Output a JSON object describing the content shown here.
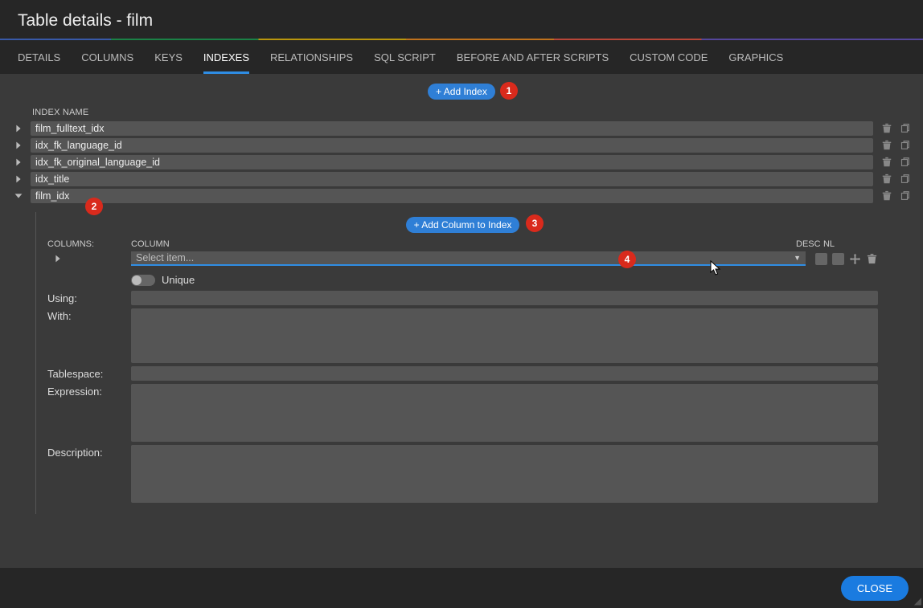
{
  "header": {
    "title": "Table details - film"
  },
  "tabs": [
    {
      "label": "DETAILS",
      "active": false
    },
    {
      "label": "COLUMNS",
      "active": false
    },
    {
      "label": "KEYS",
      "active": false
    },
    {
      "label": "INDEXES",
      "active": true
    },
    {
      "label": "RELATIONSHIPS",
      "active": false
    },
    {
      "label": "SQL SCRIPT",
      "active": false
    },
    {
      "label": "BEFORE AND AFTER SCRIPTS",
      "active": false
    },
    {
      "label": "CUSTOM CODE",
      "active": false
    },
    {
      "label": "GRAPHICS",
      "active": false
    }
  ],
  "buttons": {
    "add_index": "+ Add Index",
    "add_column_to_index": "+ Add Column to Index",
    "close": "CLOSE"
  },
  "index_section": {
    "header": "INDEX NAME",
    "rows": [
      {
        "name": "film_fulltext_idx",
        "expanded": false
      },
      {
        "name": "idx_fk_language_id",
        "expanded": false
      },
      {
        "name": "idx_fk_original_language_id",
        "expanded": false
      },
      {
        "name": "idx_title",
        "expanded": false
      },
      {
        "name": "film_idx",
        "expanded": true
      }
    ]
  },
  "expanded_index": {
    "columns_label": "COLUMNS:",
    "column_header": "COLUMN",
    "desc_header": "DESC",
    "nl_header": "NL",
    "select_placeholder": "Select item...",
    "unique_label": "Unique",
    "fields": {
      "using": {
        "label": "Using:",
        "value": ""
      },
      "with": {
        "label": "With:",
        "value": ""
      },
      "tablespace": {
        "label": "Tablespace:",
        "value": ""
      },
      "expression": {
        "label": "Expression:",
        "value": ""
      },
      "description": {
        "label": "Description:",
        "value": ""
      }
    }
  },
  "callouts": {
    "c1": "1",
    "c2": "2",
    "c3": "3",
    "c4": "4"
  },
  "colors": {
    "accent": "#2f8de4",
    "callout": "#d92a1c"
  }
}
